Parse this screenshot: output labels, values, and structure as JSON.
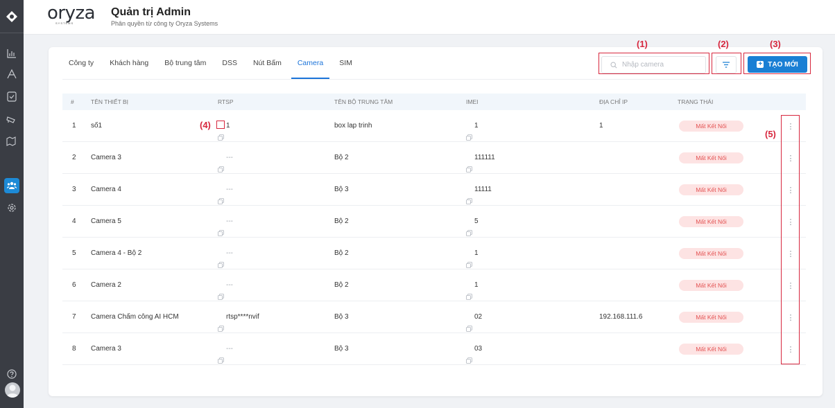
{
  "brand": {
    "name": "oryza",
    "sub": "SYSTEMS"
  },
  "header": {
    "title": "Quản trị Admin",
    "subtitle": "Phân quyền từ công ty Oryza Systems"
  },
  "sidebar": {
    "items": [
      {
        "icon": "chart-bar-icon"
      },
      {
        "icon": "font-icon"
      },
      {
        "icon": "clipboard-check-icon"
      },
      {
        "icon": "cctv-camera-icon"
      },
      {
        "icon": "map-pin-icon"
      },
      {
        "icon": "users-icon",
        "active": true
      },
      {
        "icon": "settings-icon"
      },
      {
        "icon": "help-icon"
      }
    ]
  },
  "tabs": [
    {
      "label": "Công ty"
    },
    {
      "label": "Khách hàng"
    },
    {
      "label": "Bộ trung tâm"
    },
    {
      "label": "DSS"
    },
    {
      "label": "Nút Bấm"
    },
    {
      "label": "Camera",
      "active": true
    },
    {
      "label": "SIM"
    }
  ],
  "search": {
    "placeholder": "Nhập camera"
  },
  "create_label": "TẠO MỚI",
  "columns": {
    "index": "#",
    "device": "TÊN THIẾT BỊ",
    "rtsp": "RTSP",
    "hub": "TÊN BỘ TRUNG TÂM",
    "imei": "IMEI",
    "ip": "ĐỊA CHỈ IP",
    "status": "TRẠNG THÁI"
  },
  "rows": [
    {
      "index": "1",
      "device": "số1",
      "rtsp": "1",
      "hub": "box lap trinh",
      "imei": "1",
      "ip": "1",
      "status": "Mất Kết Nối"
    },
    {
      "index": "2",
      "device": "Camera 3",
      "rtsp": "---",
      "hub": "Bộ 2",
      "imei": "111111",
      "ip": "",
      "status": "Mất Kết Nối"
    },
    {
      "index": "3",
      "device": "Camera 4",
      "rtsp": "---",
      "hub": "Bộ 3",
      "imei": "11111",
      "ip": "",
      "status": "Mất Kết Nối"
    },
    {
      "index": "4",
      "device": "Camera 5",
      "rtsp": "---",
      "hub": "Bộ 2",
      "imei": "5",
      "ip": "",
      "status": "Mất Kết Nối"
    },
    {
      "index": "5",
      "device": "Camera 4 - Bộ 2",
      "rtsp": "---",
      "hub": "Bộ 2",
      "imei": "1",
      "ip": "",
      "status": "Mất Kết Nối"
    },
    {
      "index": "6",
      "device": "Camera 2",
      "rtsp": "---",
      "hub": "Bộ 2",
      "imei": "1",
      "ip": "",
      "status": "Mất Kết Nối"
    },
    {
      "index": "7",
      "device": "Camera Chấm công AI HCM",
      "rtsp": "rtsp****nvif",
      "hub": "Bộ 3",
      "imei": "02",
      "ip": "192.168.111.6",
      "status": "Mất Kết Nối"
    },
    {
      "index": "8",
      "device": "Camera 3",
      "rtsp": "---",
      "hub": "Bộ 3",
      "imei": "03",
      "ip": "",
      "status": "Mất Kết Nối"
    }
  ],
  "annotations": {
    "a1": "(1)",
    "a2": "(2)",
    "a3": "(3)",
    "a4": "(4)",
    "a5": "(5)"
  },
  "colors": {
    "sidebar_bg": "#3a3d44",
    "accent": "#1a7fd4",
    "status_bg": "#fde3e3",
    "status_text": "#e35050",
    "annotation": "#d7263d"
  }
}
